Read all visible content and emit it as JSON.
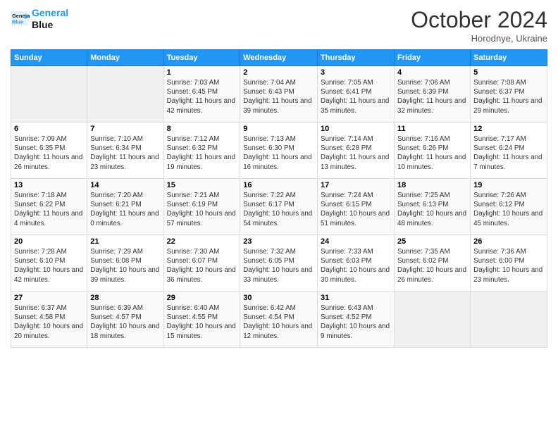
{
  "header": {
    "logo_line1": "General",
    "logo_line2": "Blue",
    "month": "October 2024",
    "location": "Horodnye, Ukraine"
  },
  "weekdays": [
    "Sunday",
    "Monday",
    "Tuesday",
    "Wednesday",
    "Thursday",
    "Friday",
    "Saturday"
  ],
  "weeks": [
    [
      {
        "day": "",
        "info": ""
      },
      {
        "day": "",
        "info": ""
      },
      {
        "day": "1",
        "info": "Sunrise: 7:03 AM\nSunset: 6:45 PM\nDaylight: 11 hours and 42 minutes."
      },
      {
        "day": "2",
        "info": "Sunrise: 7:04 AM\nSunset: 6:43 PM\nDaylight: 11 hours and 39 minutes."
      },
      {
        "day": "3",
        "info": "Sunrise: 7:05 AM\nSunset: 6:41 PM\nDaylight: 11 hours and 35 minutes."
      },
      {
        "day": "4",
        "info": "Sunrise: 7:06 AM\nSunset: 6:39 PM\nDaylight: 11 hours and 32 minutes."
      },
      {
        "day": "5",
        "info": "Sunrise: 7:08 AM\nSunset: 6:37 PM\nDaylight: 11 hours and 29 minutes."
      }
    ],
    [
      {
        "day": "6",
        "info": "Sunrise: 7:09 AM\nSunset: 6:35 PM\nDaylight: 11 hours and 26 minutes."
      },
      {
        "day": "7",
        "info": "Sunrise: 7:10 AM\nSunset: 6:34 PM\nDaylight: 11 hours and 23 minutes."
      },
      {
        "day": "8",
        "info": "Sunrise: 7:12 AM\nSunset: 6:32 PM\nDaylight: 11 hours and 19 minutes."
      },
      {
        "day": "9",
        "info": "Sunrise: 7:13 AM\nSunset: 6:30 PM\nDaylight: 11 hours and 16 minutes."
      },
      {
        "day": "10",
        "info": "Sunrise: 7:14 AM\nSunset: 6:28 PM\nDaylight: 11 hours and 13 minutes."
      },
      {
        "day": "11",
        "info": "Sunrise: 7:16 AM\nSunset: 6:26 PM\nDaylight: 11 hours and 10 minutes."
      },
      {
        "day": "12",
        "info": "Sunrise: 7:17 AM\nSunset: 6:24 PM\nDaylight: 11 hours and 7 minutes."
      }
    ],
    [
      {
        "day": "13",
        "info": "Sunrise: 7:18 AM\nSunset: 6:22 PM\nDaylight: 11 hours and 4 minutes."
      },
      {
        "day": "14",
        "info": "Sunrise: 7:20 AM\nSunset: 6:21 PM\nDaylight: 11 hours and 0 minutes."
      },
      {
        "day": "15",
        "info": "Sunrise: 7:21 AM\nSunset: 6:19 PM\nDaylight: 10 hours and 57 minutes."
      },
      {
        "day": "16",
        "info": "Sunrise: 7:22 AM\nSunset: 6:17 PM\nDaylight: 10 hours and 54 minutes."
      },
      {
        "day": "17",
        "info": "Sunrise: 7:24 AM\nSunset: 6:15 PM\nDaylight: 10 hours and 51 minutes."
      },
      {
        "day": "18",
        "info": "Sunrise: 7:25 AM\nSunset: 6:13 PM\nDaylight: 10 hours and 48 minutes."
      },
      {
        "day": "19",
        "info": "Sunrise: 7:26 AM\nSunset: 6:12 PM\nDaylight: 10 hours and 45 minutes."
      }
    ],
    [
      {
        "day": "20",
        "info": "Sunrise: 7:28 AM\nSunset: 6:10 PM\nDaylight: 10 hours and 42 minutes."
      },
      {
        "day": "21",
        "info": "Sunrise: 7:29 AM\nSunset: 6:08 PM\nDaylight: 10 hours and 39 minutes."
      },
      {
        "day": "22",
        "info": "Sunrise: 7:30 AM\nSunset: 6:07 PM\nDaylight: 10 hours and 36 minutes."
      },
      {
        "day": "23",
        "info": "Sunrise: 7:32 AM\nSunset: 6:05 PM\nDaylight: 10 hours and 33 minutes."
      },
      {
        "day": "24",
        "info": "Sunrise: 7:33 AM\nSunset: 6:03 PM\nDaylight: 10 hours and 30 minutes."
      },
      {
        "day": "25",
        "info": "Sunrise: 7:35 AM\nSunset: 6:02 PM\nDaylight: 10 hours and 26 minutes."
      },
      {
        "day": "26",
        "info": "Sunrise: 7:36 AM\nSunset: 6:00 PM\nDaylight: 10 hours and 23 minutes."
      }
    ],
    [
      {
        "day": "27",
        "info": "Sunrise: 6:37 AM\nSunset: 4:58 PM\nDaylight: 10 hours and 20 minutes."
      },
      {
        "day": "28",
        "info": "Sunrise: 6:39 AM\nSunset: 4:57 PM\nDaylight: 10 hours and 18 minutes."
      },
      {
        "day": "29",
        "info": "Sunrise: 6:40 AM\nSunset: 4:55 PM\nDaylight: 10 hours and 15 minutes."
      },
      {
        "day": "30",
        "info": "Sunrise: 6:42 AM\nSunset: 4:54 PM\nDaylight: 10 hours and 12 minutes."
      },
      {
        "day": "31",
        "info": "Sunrise: 6:43 AM\nSunset: 4:52 PM\nDaylight: 10 hours and 9 minutes."
      },
      {
        "day": "",
        "info": ""
      },
      {
        "day": "",
        "info": ""
      }
    ]
  ]
}
